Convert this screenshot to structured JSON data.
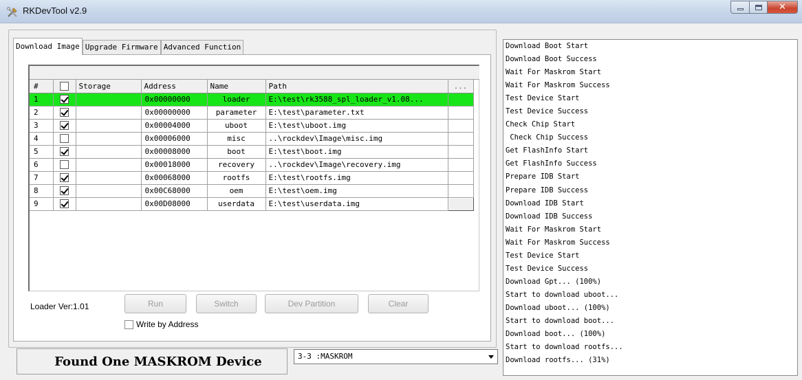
{
  "window": {
    "title": "RKDevTool v2.9"
  },
  "tabs": [
    {
      "label": "Download Image",
      "active": true
    },
    {
      "label": "Upgrade Firmware",
      "active": false
    },
    {
      "label": "Advanced Function",
      "active": false
    }
  ],
  "table": {
    "headers": {
      "index": "#",
      "storage": "Storage",
      "address": "Address",
      "name": "Name",
      "path": "Path",
      "more": "..."
    },
    "rows": [
      {
        "index": "1",
        "checked": true,
        "storage": "",
        "address": "0x00000000",
        "name": "loader",
        "path": "E:\\test\\rk3588_spl_loader_v1.08...",
        "selected": true
      },
      {
        "index": "2",
        "checked": true,
        "storage": "",
        "address": "0x00000000",
        "name": "parameter",
        "path": "E:\\test\\parameter.txt",
        "selected": false
      },
      {
        "index": "3",
        "checked": true,
        "storage": "",
        "address": "0x00004000",
        "name": "uboot",
        "path": "E:\\test\\uboot.img",
        "selected": false
      },
      {
        "index": "4",
        "checked": false,
        "storage": "",
        "address": "0x00006000",
        "name": "misc",
        "path": "..\\rockdev\\Image\\misc.img",
        "selected": false
      },
      {
        "index": "5",
        "checked": true,
        "storage": "",
        "address": "0x00008000",
        "name": "boot",
        "path": "E:\\test\\boot.img",
        "selected": false
      },
      {
        "index": "6",
        "checked": false,
        "storage": "",
        "address": "0x00018000",
        "name": "recovery",
        "path": "..\\rockdev\\Image\\recovery.img",
        "selected": false
      },
      {
        "index": "7",
        "checked": true,
        "storage": "",
        "address": "0x00068000",
        "name": "rootfs",
        "path": "E:\\test\\rootfs.img",
        "selected": false
      },
      {
        "index": "8",
        "checked": true,
        "storage": "",
        "address": "0x00C68000",
        "name": "oem",
        "path": "E:\\test\\oem.img",
        "selected": false
      },
      {
        "index": "9",
        "checked": true,
        "storage": "",
        "address": "0x00D08000",
        "name": "userdata",
        "path": "E:\\test\\userdata.img",
        "selected": false
      }
    ]
  },
  "loader_version": "Loader Ver:1.01",
  "buttons": {
    "run": "Run",
    "switch": "Switch",
    "dev_partition": "Dev Partition",
    "clear": "Clear"
  },
  "write_by_address": {
    "label": "Write by Address",
    "checked": false
  },
  "status": {
    "message": "Found One MASKROM Device"
  },
  "device_select": {
    "value": "3-3 :MASKROM"
  },
  "log": [
    "Download Boot Start",
    "Download Boot Success",
    "Wait For Maskrom Start",
    "Wait For Maskrom Success",
    "Test Device Start",
    "Test Device Success",
    "Check Chip Start",
    " Check Chip Success",
    "Get FlashInfo Start",
    "Get FlashInfo Success",
    "Prepare IDB Start",
    "Prepare IDB Success",
    "Download IDB Start",
    "Download IDB Success",
    "Wait For Maskrom Start",
    "Wait For Maskrom Success",
    "Test Device Start",
    "Test Device Success",
    "Download Gpt... (100%)",
    "Start to download uboot...",
    "Download uboot... (100%)",
    "Start to download boot...",
    "Download boot... (100%)",
    "Start to download rootfs...",
    "Download rootfs... (31%)"
  ],
  "colors": {
    "selected_row": "#18e518",
    "title_bar": "#c7d6ea",
    "close_button": "#c9462f"
  },
  "icons": {
    "app": "tools-icon",
    "minimize": "minimize-icon",
    "maximize": "maximize-icon",
    "close": "close-icon"
  }
}
